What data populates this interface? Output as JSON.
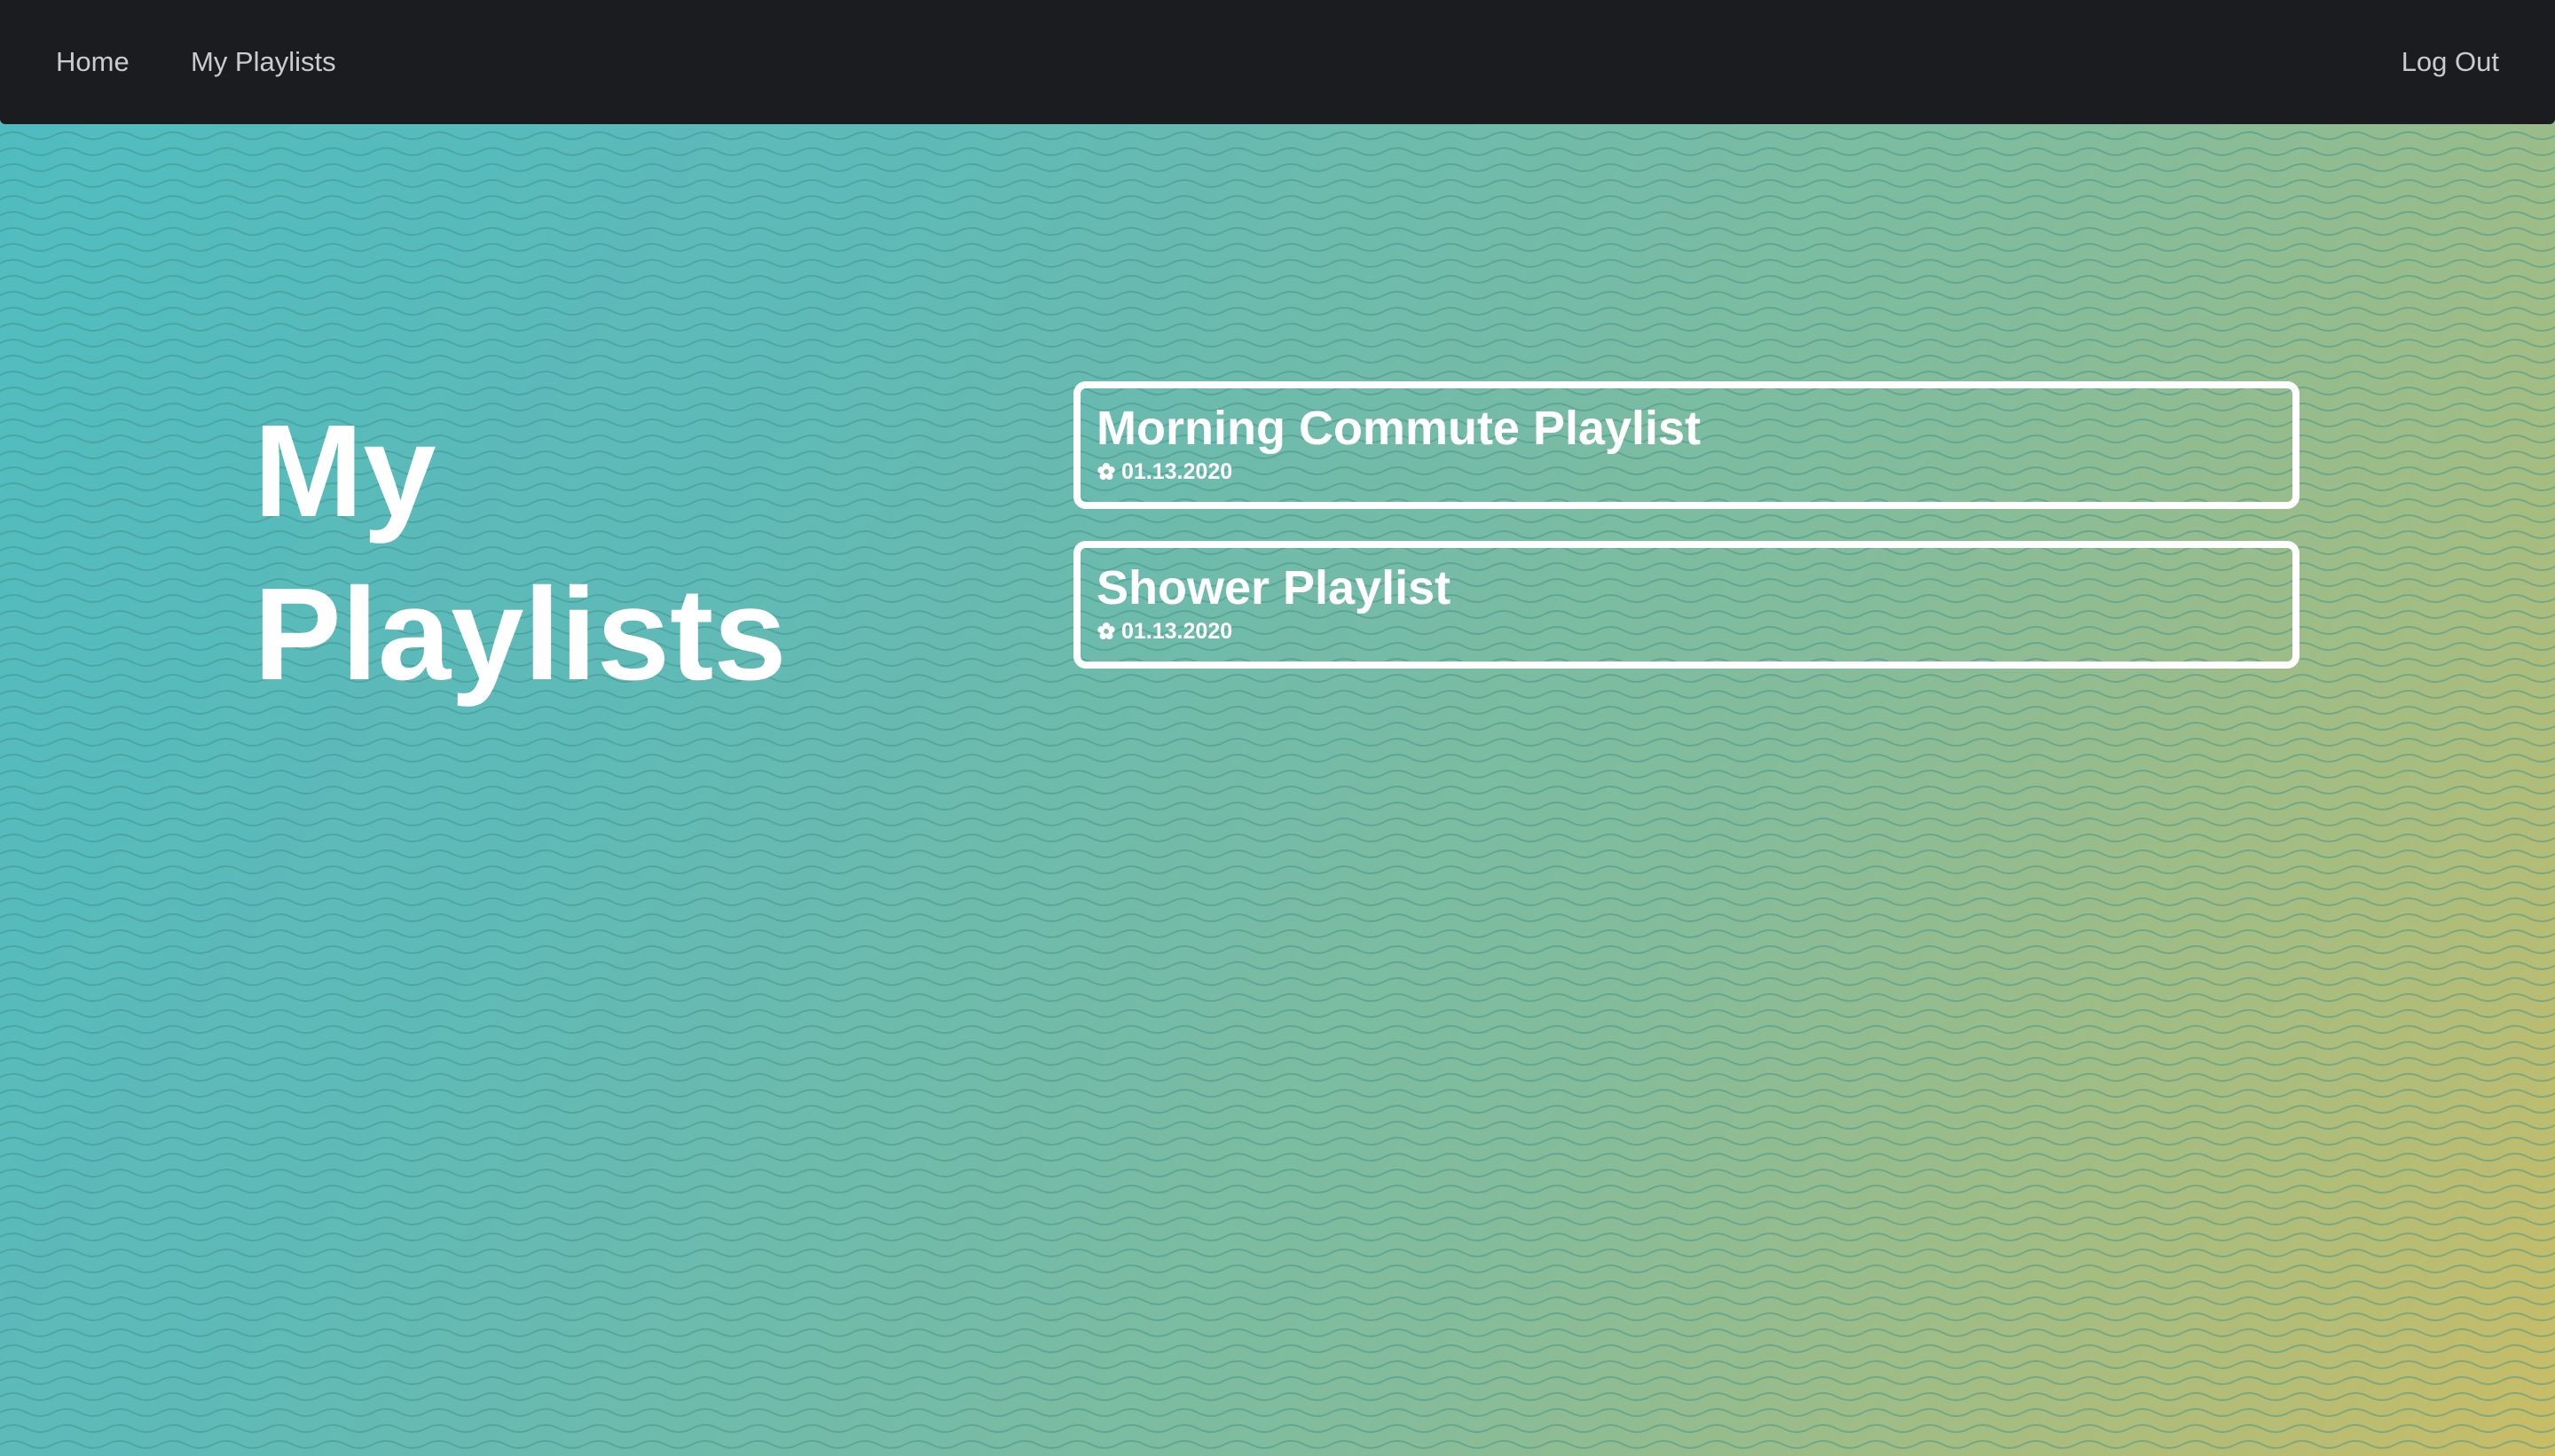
{
  "nav": {
    "home_label": "Home",
    "my_playlists_label": "My Playlists",
    "logout_label": "Log Out"
  },
  "page": {
    "title_line1": "My",
    "title_line2": "Playlists"
  },
  "playlists": [
    {
      "name": "Morning Commute Playlist",
      "date": "01.13.2020",
      "icon": "flower-icon"
    },
    {
      "name": "Shower Playlist",
      "date": "01.13.2020",
      "icon": "flower-icon"
    }
  ],
  "colors": {
    "navbar": "#1b1c1f",
    "nav_text": "#c9cbcf",
    "gradient_start": "#4fbcc0",
    "gradient_end": "#c9bd66",
    "card_border": "#ffffff"
  }
}
